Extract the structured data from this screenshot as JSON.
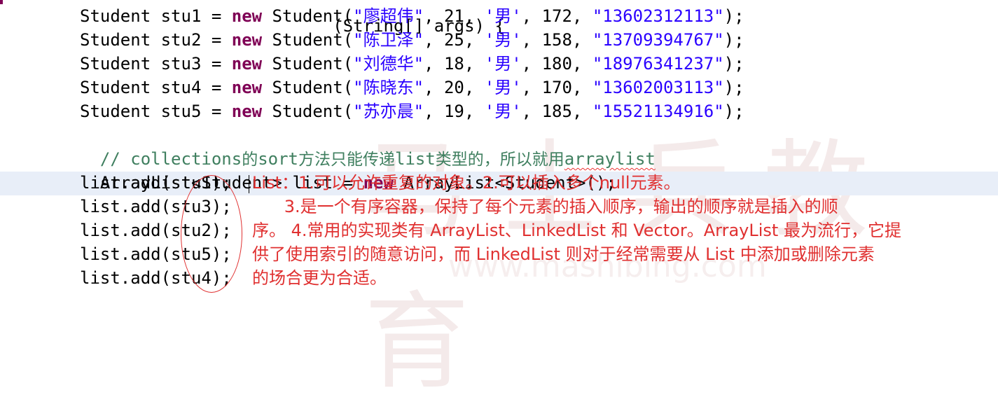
{
  "editor": {
    "top_cut_line": "(String[] args) {",
    "student_lines": [
      {
        "var": "stu1",
        "name": "\"廖超伟\"",
        "age": "21",
        "gender": "'男'",
        "height": "172",
        "phone": "\"13602312113\""
      },
      {
        "var": "stu2",
        "name": "\"陈卫泽\"",
        "age": "25",
        "gender": "'男'",
        "height": "158",
        "phone": "\"13709394767\""
      },
      {
        "var": "stu3",
        "name": "\"刘德华\"",
        "age": "18",
        "gender": "'男'",
        "height": "180",
        "phone": "\"18976341237\""
      },
      {
        "var": "stu4",
        "name": "\"陈晓东\"",
        "age": "20",
        "gender": "'男'",
        "height": "170",
        "phone": "\"13602003113\""
      },
      {
        "var": "stu5",
        "name": "\"苏亦晨\"",
        "age": "19",
        "gender": "'男'",
        "height": "185",
        "phone": "\"15521134916\""
      }
    ],
    "comment_prefix": "// collections",
    "comment_part1": "的",
    "comment_code1": "sort",
    "comment_part2": "方法只能传递",
    "comment_code2": "list",
    "comment_part3": "类型的，所以就用",
    "comment_code3": "arraylist",
    "arraylist_decl_start": "ArrayList<Student> list = ",
    "arraylist_decl_end": " ArrayList<Student>();",
    "kw_new": "new",
    "kw_student_prefix": "Student ",
    "kw_student_mid": " = ",
    "kw_student_ctor": " Student(",
    "add_lines": [
      "list.add(stu1);",
      "list.add(stu3);",
      "list.add(stu2);",
      "list.add(stu5);",
      "list.add(stu4);"
    ]
  },
  "annotation": {
    "lines": [
      "List：1.可以允许重复的对象。2.可以插入多个null元素。",
      "      3.是一个有序容器，保持了每个元素的插入顺序，输出的顺序就是插入的顺",
      "序。 4.常用的实现类有 ArrayList、LinkedList 和 Vector。ArrayList 最为流行，它提",
      "供了使用索引的随意访问，而 LinkedList 则对于经常需要从 List 中添加或删除元素",
      "的场合更为合适。"
    ]
  },
  "watermark": {
    "text": "马士兵教育",
    "url": "www.mashibing.com"
  },
  "colors": {
    "keyword": "#7f0055",
    "string": "#2a00ff",
    "comment": "#3f7f5f",
    "annotation": "#e03030",
    "highlight_line": "#e8eef8"
  }
}
